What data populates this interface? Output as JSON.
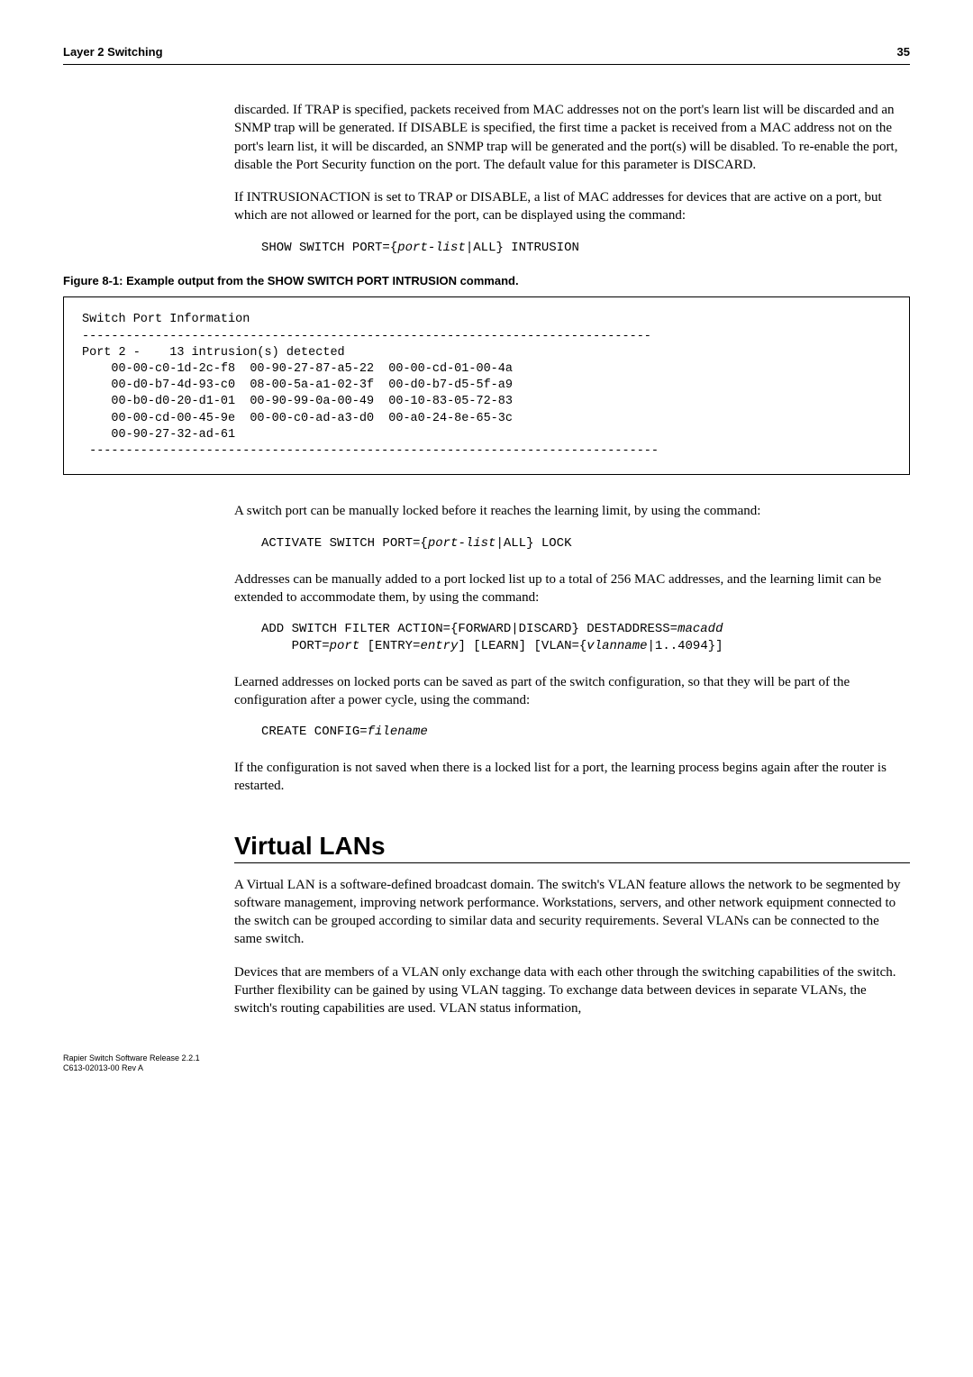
{
  "header": {
    "left": "Layer 2 Switching",
    "right": "35"
  },
  "para1": "discarded. If TRAP is specified, packets received from MAC addresses not on the port's learn list will be discarded and an SNMP trap will be generated. If DISABLE is specified, the first time a packet is received from a MAC address not on the port's learn list, it will be discarded, an SNMP trap will be generated and the port(s) will be disabled. To re-enable the port, disable the Port Security function on the port. The default value for this parameter is DISCARD.",
  "para2": "If INTRUSIONACTION is set to TRAP or DISABLE, a list of MAC addresses for devices that are active on a port, but which are not allowed or learned for the port, can be displayed using the command:",
  "cmd1a": "SHOW SWITCH PORT={",
  "cmd1b": "port-list",
  "cmd1c": "|ALL} INTRUSION",
  "figcaption": "Figure 8-1: Example output from the SHOW SWITCH PORT INTRUSION command.",
  "codebox": "Switch Port Information\n------------------------------------------------------------------------------\nPort 2 -    13 intrusion(s) detected\n    00-00-c0-1d-2c-f8  00-90-27-87-a5-22  00-00-cd-01-00-4a\n    00-d0-b7-4d-93-c0  08-00-5a-a1-02-3f  00-d0-b7-d5-5f-a9\n    00-b0-d0-20-d1-01  00-90-99-0a-00-49  00-10-83-05-72-83\n    00-00-cd-00-45-9e  00-00-c0-ad-a3-d0  00-a0-24-8e-65-3c\n    00-90-27-32-ad-61\n ------------------------------------------------------------------------------",
  "para3": "A switch port can be manually locked before it reaches the learning limit, by using the command:",
  "cmd2a": "ACTIVATE SWITCH PORT={",
  "cmd2b": "port-list",
  "cmd2c": "|ALL} LOCK",
  "para4": "Addresses can be manually added to a port locked list up to a total of 256 MAC addresses, and the learning limit can be extended to accommodate them, by using the command:",
  "cmd3a": "ADD SWITCH FILTER ACTION={FORWARD|DISCARD} DESTADDRESS=",
  "cmd3b": "macadd",
  "cmd3c": "    PORT=",
  "cmd3d": "port",
  "cmd3e": " [ENTRY=",
  "cmd3f": "entry",
  "cmd3g": "] [LEARN] [VLAN={",
  "cmd3h": "vlanname",
  "cmd3i": "|1..4094}]",
  "para5": "Learned addresses on locked ports can be saved as part of the switch configuration, so that they will be part of the configuration after a power cycle, using the command:",
  "cmd4a": "CREATE CONFIG=",
  "cmd4b": "filename",
  "para6": "If the configuration is not saved when there is a locked list for a port, the learning process begins again after the router is restarted.",
  "h1": "Virtual LANs",
  "para7": "A Virtual LAN is a software-defined broadcast domain. The switch's VLAN feature allows the network to be segmented by software management, improving network performance. Workstations, servers, and other network equipment connected to the switch can be grouped according to similar data and security requirements. Several VLANs can be connected to the same switch.",
  "para8": "Devices that are members of a VLAN only exchange data with each other through the switching capabilities of the switch. Further flexibility can be gained by using VLAN tagging. To exchange data between devices in separate VLANs, the switch's routing capabilities are used. VLAN status information,",
  "footer1": "Rapier Switch Software Release 2.2.1",
  "footer2": "C613-02013-00 Rev A"
}
